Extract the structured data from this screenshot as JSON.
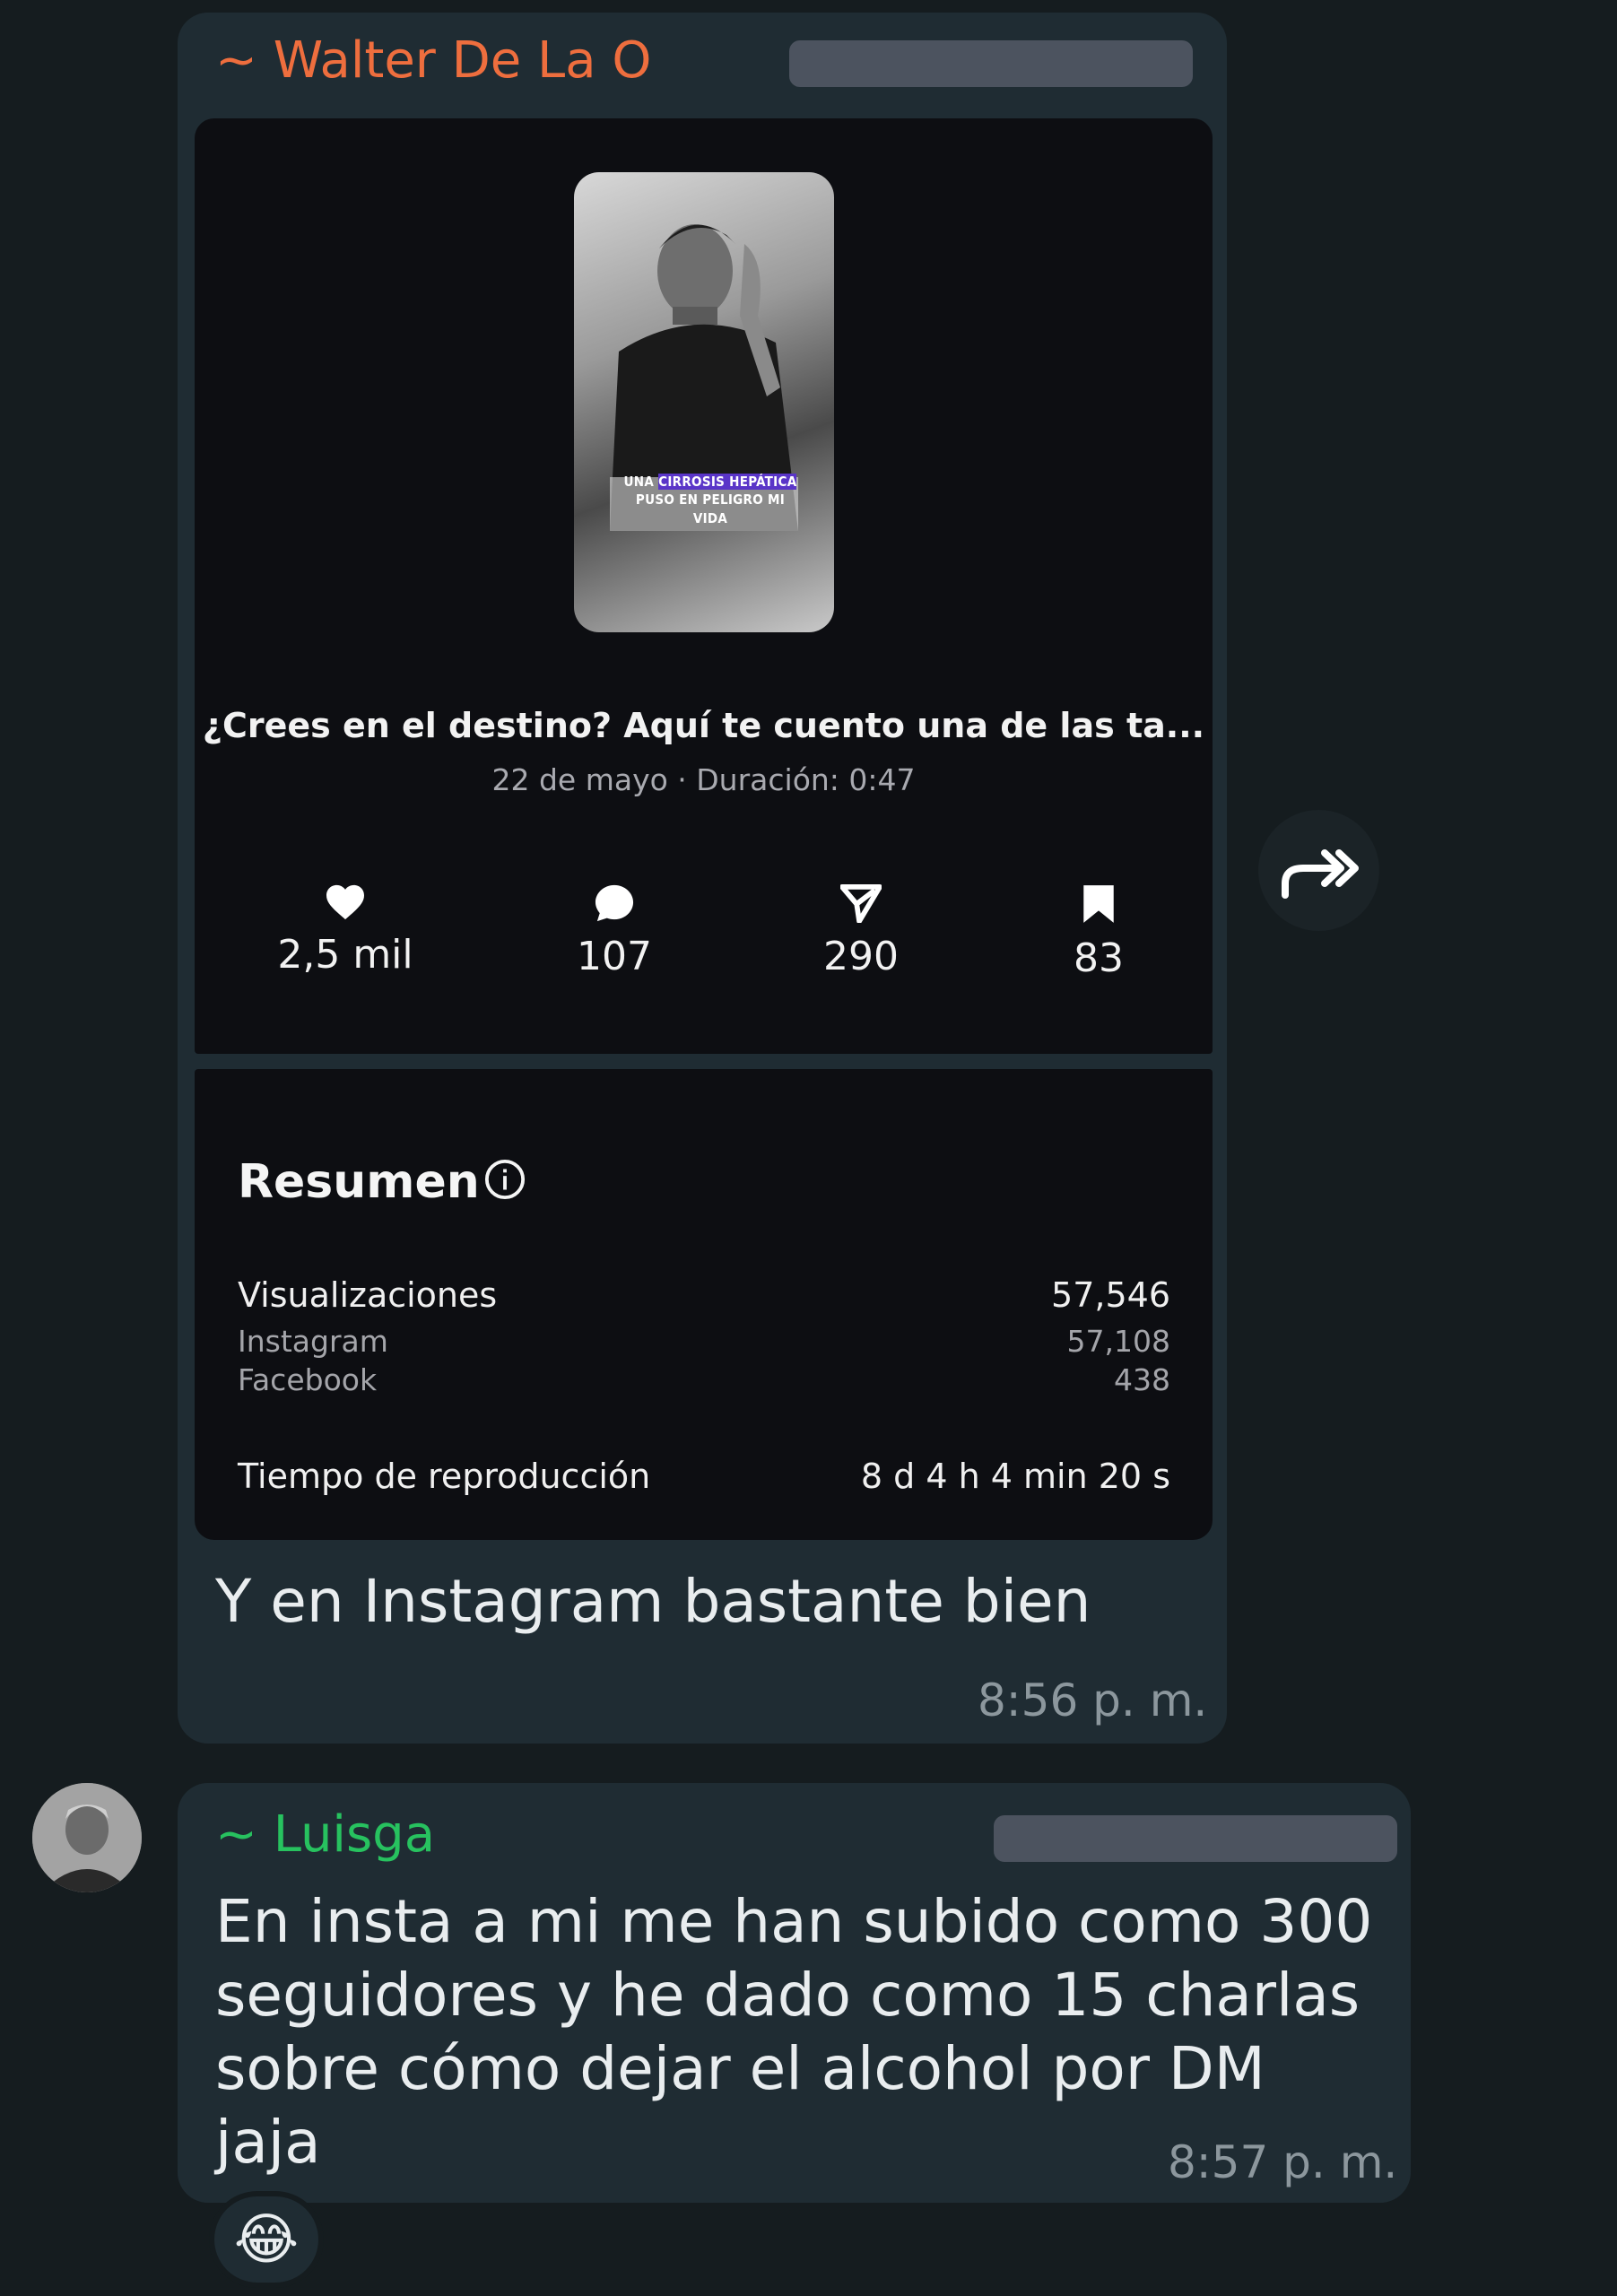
{
  "colors": {
    "background": "#151c1f",
    "bubble": "#1f2c33",
    "sender1": "#ee6e3e",
    "sender2": "#27c25f",
    "timestamp": "#8c979d"
  },
  "message1": {
    "sender": "~ Walter De La O",
    "preview": {
      "thumbnail_caption_line1_pre": "UNA",
      "thumbnail_caption_line1_hl": "CIRROSIS HEPÁTICA",
      "thumbnail_caption_line2": "PUSO EN PELIGRO MI VIDA",
      "title": "¿Crees en el destino? Aquí te cuento una de las ta...",
      "meta": "22 de mayo · Duración: 0:47",
      "stats": {
        "likes": "2,5 mil",
        "comments": "107",
        "shares": "290",
        "saves": "83"
      }
    },
    "summary": {
      "title": "Resumen",
      "views_label": "Visualizaciones",
      "views_value": "57,546",
      "instagram_label": "Instagram",
      "instagram_value": "57,108",
      "facebook_label": "Facebook",
      "facebook_value": "438",
      "watch_time_label": "Tiempo de reproducción",
      "watch_time_value": "8 d 4 h 4 min 20 s"
    },
    "text": "Y en Instagram bastante bien",
    "time": "8:56 p. m."
  },
  "message2": {
    "sender": "~ Luisga",
    "text_line1": "En insta a mi me han subido como 300",
    "text_line2": "seguidores y he dado como 15 charlas",
    "text_line3": "sobre cómo dejar el alcohol por DM jaja",
    "time": "8:57 p. m.",
    "reaction": "😂"
  },
  "icons": {
    "like": "heart-icon",
    "comment": "comment-bubble-icon",
    "share": "send-icon",
    "save": "bookmark-icon",
    "info": "info-icon",
    "forward": "forward-icon"
  }
}
